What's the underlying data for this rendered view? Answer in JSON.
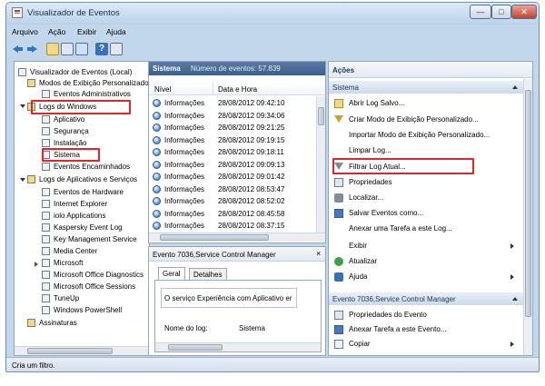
{
  "window": {
    "title": "Visualizador de Eventos"
  },
  "menu": [
    "Arquivo",
    "Ação",
    "Exibir",
    "Ajuda"
  ],
  "tree": {
    "items": [
      {
        "label": "Visualizador de Eventos (Local)",
        "level": 0
      },
      {
        "label": "Modos de Exibição Personalizados",
        "level": 1
      },
      {
        "label": "Eventos Administrativos",
        "level": 2
      },
      {
        "label": "Logs do Windows",
        "level": 1
      },
      {
        "label": "Aplicativo",
        "level": 2
      },
      {
        "label": "Segurança",
        "level": 2
      },
      {
        "label": "Instalação",
        "level": 2
      },
      {
        "label": "Sistema",
        "level": 2
      },
      {
        "label": "Eventos Encaminhados",
        "level": 2
      },
      {
        "label": "Logs de Aplicativos e Serviços",
        "level": 1
      },
      {
        "label": "Eventos de Hardware",
        "level": 2
      },
      {
        "label": "Internet Explorer",
        "level": 2
      },
      {
        "label": "iolo Applications",
        "level": 2
      },
      {
        "label": "Kaspersky Event Log",
        "level": 2
      },
      {
        "label": "Key Management Service",
        "level": 2
      },
      {
        "label": "Media Center",
        "level": 2
      },
      {
        "label": "Microsoft",
        "level": 2
      },
      {
        "label": "Microsoft Office Diagnostics",
        "level": 2
      },
      {
        "label": "Microsoft Office Sessions",
        "level": 2
      },
      {
        "label": "TuneUp",
        "level": 2
      },
      {
        "label": "Windows PowerShell",
        "level": 2
      },
      {
        "label": "Assinaturas",
        "level": 1
      }
    ]
  },
  "log": {
    "name": "Sistema",
    "count_label": "Número de eventos: 57.839",
    "columns": [
      "Nível",
      "Data e Hora"
    ],
    "rows": [
      {
        "level": "Informações",
        "datetime": "28/08/2012 09:42:10"
      },
      {
        "level": "Informações",
        "datetime": "28/08/2012 09:34:06"
      },
      {
        "level": "Informações",
        "datetime": "28/08/2012 09:21:25"
      },
      {
        "level": "Informações",
        "datetime": "28/08/2012 09:19:15"
      },
      {
        "level": "Informações",
        "datetime": "28/08/2012 09:18:11"
      },
      {
        "level": "Informações",
        "datetime": "28/08/2012 09:09:13"
      },
      {
        "level": "Informações",
        "datetime": "28/08/2012 09:01:42"
      },
      {
        "level": "Informações",
        "datetime": "28/08/2012 08:53:47"
      },
      {
        "level": "Informações",
        "datetime": "28/08/2012 08:52:02"
      },
      {
        "level": "Informações",
        "datetime": "28/08/2012 08:45:58"
      },
      {
        "level": "Informações",
        "datetime": "28/08/2012 08:37:15"
      }
    ]
  },
  "event": {
    "title": "Evento 7036,Service Control Manager",
    "tabs": [
      "Geral",
      "Detalhes"
    ],
    "description": "O serviço Experiência com Aplicativo er",
    "log_name_label": "Nome do log:",
    "log_name_value": "Sistema"
  },
  "actions": {
    "title": "Ações",
    "section1": "Sistema",
    "items1": [
      "Abrir Log Salvo...",
      "Criar Modo de Exibição Personalizado...",
      "Importar Modo de Exibição Personalizado...",
      "Limpar Log...",
      "Filtrar Log Atual...",
      "Propriedades",
      "Localizar...",
      "Salvar Eventos como...",
      "Anexar uma Tarefa a este Log...",
      "Exibir",
      "Atualizar",
      "Ajuda"
    ],
    "section2": "Evento 7036,Service Control Manager",
    "items2": [
      "Propriedades do Evento",
      "Anexar Tarefa a este Evento...",
      "Copiar"
    ]
  },
  "status": "Cria um filtro.",
  "colors": {
    "highlight_box": "#e0262b",
    "panel_header": "#4a6a95"
  }
}
